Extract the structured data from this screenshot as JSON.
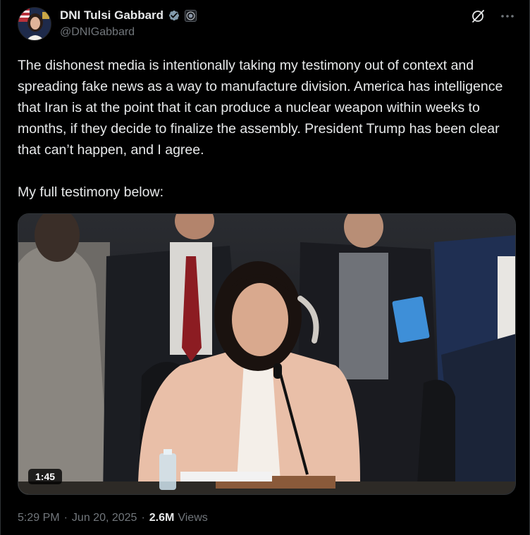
{
  "author": {
    "display_name": "DNI Tulsi Gabbard",
    "handle": "@DNIGabbard",
    "verified_color": "#829aab"
  },
  "icons": {
    "verified": "verified-badge-icon",
    "gov": "government-seal-icon",
    "grok": "grok-icon",
    "more": "more-options-icon"
  },
  "tweet": {
    "text": "The dishonest media is intentionally taking my testimony out of context and spreading fake news as a way to manufacture division. America has intelligence that Iran is at the point that it can produce a nuclear weapon within weeks to months, if they decide to finalize the assembly. President Trump has been clear that can’t happen, and I agree.\n\nMy full testimony below:"
  },
  "media": {
    "type": "video",
    "duration": "1:45"
  },
  "meta": {
    "time": "5:29 PM",
    "date": "Jun 20, 2025",
    "views_count": "2.6M",
    "views_label": "Views",
    "separator": "·"
  }
}
